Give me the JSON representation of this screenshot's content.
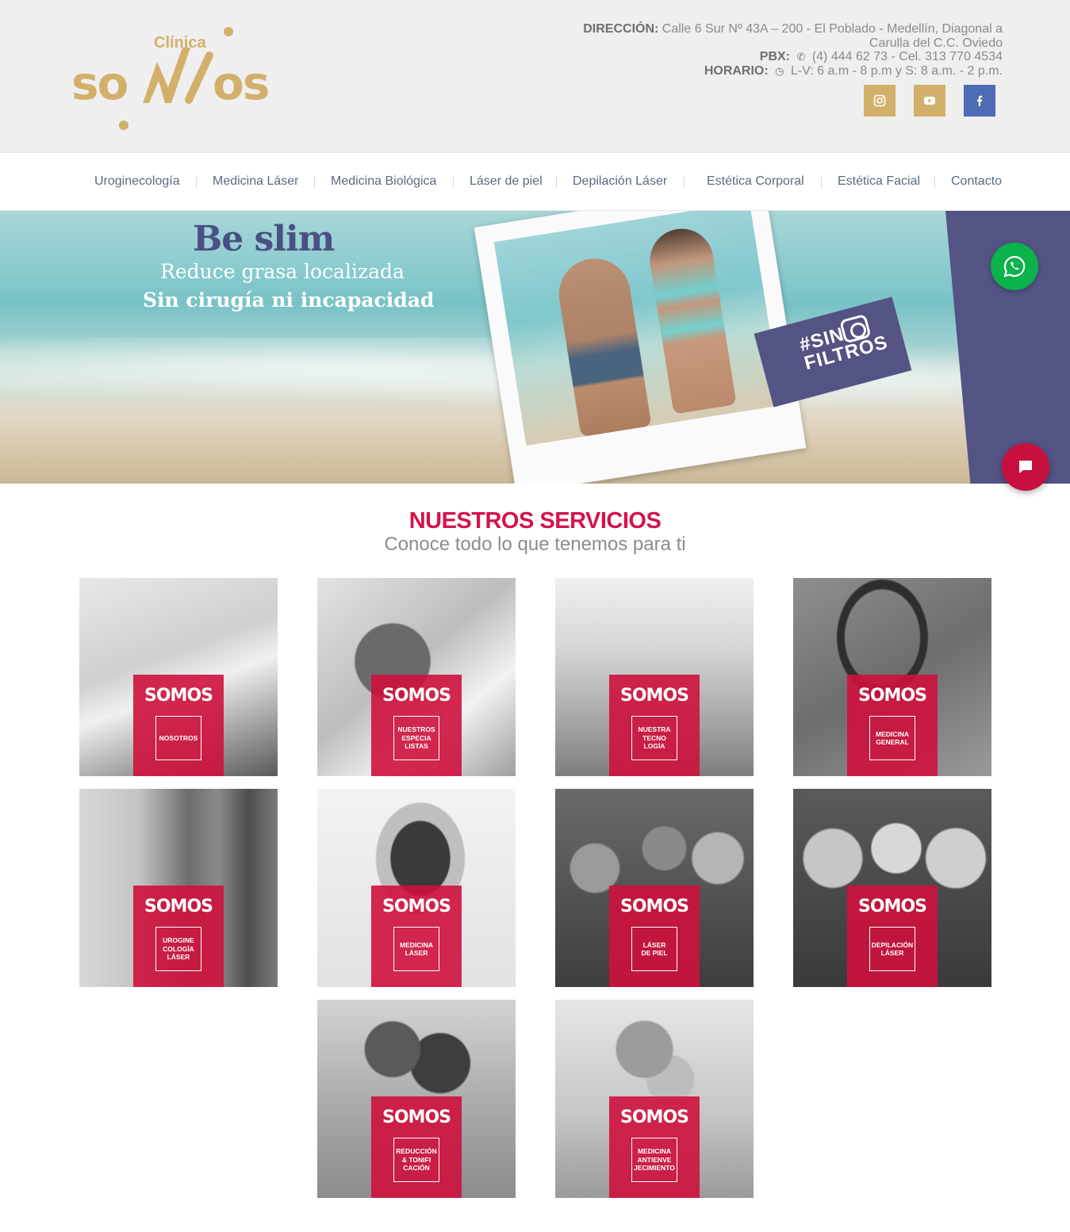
{
  "brand": {
    "prefix": "Clínica",
    "name": "SOMOS",
    "color": "#d3b06a"
  },
  "contact": {
    "address_label": "DIRECCIÓN:",
    "address_line1": "Calle 6 Sur Nº 43A – 200 - El Poblado - Medellín, Diagonal a",
    "address_line2": "Carulla del C.C. Oviedo",
    "phone_label": "PBX:",
    "phone": "(4) 444 62 73 - Cel. 313 770 4534",
    "hours_label": "HORARIO:",
    "hours": "L-V: 6 a.m - 8 p.m y S: 8 a.m. - 2 p.m."
  },
  "socials": [
    {
      "icon": "instagram-icon",
      "color": "#d3b06a"
    },
    {
      "icon": "youtube-icon",
      "color": "#d3b06a"
    },
    {
      "icon": "facebook-icon",
      "color": "#4d6cb3"
    }
  ],
  "nav": {
    "items": [
      "Uroginecología",
      "Medicina Láser",
      "Medicina Biológica",
      "Láser de piel",
      "Depilación Láser",
      "Estética Corporal",
      "Estética Facial",
      "Contacto"
    ]
  },
  "hero": {
    "title": "Be slim",
    "subtitle": "Reduce grasa localizada",
    "tagline": "Sin cirugía ni incapacidad",
    "badge_line1": "#SIN",
    "badge_line2": "FILTROS"
  },
  "services": {
    "title": "NUESTROS SERVICIOS",
    "subtitle": "Conoce todo lo que tenemos para ti",
    "card_logo": "SOMOS",
    "cards": [
      "NOSOTROS",
      "NUESTROS\nESPECIA\nLISTAS",
      "NUESTRA\nTECNO\nLOGÍA",
      "MEDICINA\nGENERAL",
      "UROGINE\nCOLOGÍA\nLÁSER",
      "MEDICINA\nLÁSER",
      "LÁSER\nDE PIEL",
      "DEPILACIÓN\nLÁSER",
      "REDUCCIÓN\n& TONIFI\nCACIÓN",
      "MEDICINA\nANTIENVE\nJECIMIENTO"
    ]
  },
  "colors": {
    "accent_red": "#d4134a",
    "hero_purple": "#535384",
    "whatsapp_green": "#0bb34a",
    "nav_text": "#5c6a7e"
  }
}
